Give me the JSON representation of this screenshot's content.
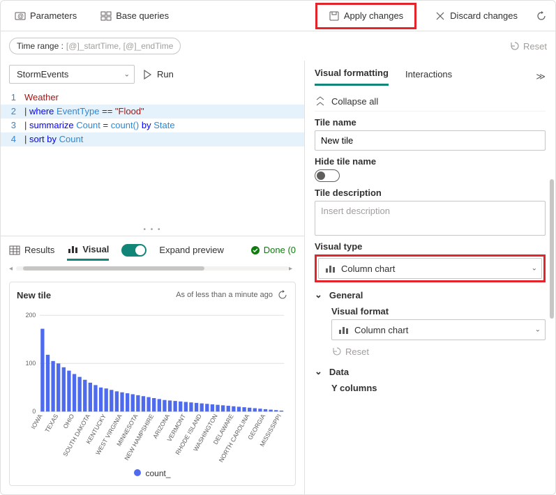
{
  "topbar": {
    "parameters": "Parameters",
    "base_queries": "Base queries",
    "apply": "Apply changes",
    "discard": "Discard changes"
  },
  "time_range": {
    "label": "Time range :",
    "value": "[@]_startTime, [@]_endTime"
  },
  "reset": "Reset",
  "datasource": "StormEvents",
  "run": "Run",
  "editor": {
    "l1": "Weather",
    "l2_kw": "where",
    "l2_col": "EventType",
    "l2_op": "==",
    "l2_str": "\"Flood\"",
    "l3_kw": "summarize",
    "l3_col": "Count",
    "l3_eq": "=",
    "l3_fn": "count()",
    "l3_by": "by",
    "l3_col2": "State",
    "l4_kw": "sort by",
    "l4_col": "Count",
    "ln1": "1",
    "ln2": "2",
    "ln3": "3",
    "ln4": "4"
  },
  "result_tabs": {
    "results": "Results",
    "visual": "Visual",
    "expand": "Expand preview",
    "done": "Done (0"
  },
  "tile": {
    "title": "New tile",
    "meta": "As of less than a minute ago"
  },
  "legend": "count_",
  "right": {
    "tab1": "Visual formatting",
    "tab2": "Interactions",
    "collapse": "Collapse all",
    "tile_name_label": "Tile name",
    "tile_name_value": "New tile",
    "hide_label": "Hide tile name",
    "desc_label": "Tile description",
    "desc_placeholder": "Insert description",
    "vtype_label": "Visual type",
    "vtype_value": "Column chart",
    "general": "General",
    "vformat_label": "Visual format",
    "vformat_value": "Column chart",
    "reset": "Reset",
    "data": "Data",
    "ycols": "Y columns"
  },
  "chart_data": {
    "type": "bar",
    "title": "New tile",
    "xlabel": "",
    "ylabel": "",
    "ylim": [
      0,
      200
    ],
    "yticks": [
      0,
      100,
      200
    ],
    "legend": [
      "count_"
    ],
    "categories": [
      "IOWA",
      "TEXAS",
      "OHIO",
      "SOUTH DAKOTA",
      "KENTUCKY",
      "WEST VIRGINIA",
      "MINNESOTA",
      "NEW HAMPSHIRE",
      "ARIZONA",
      "VERMONT",
      "RHODE ISLAND",
      "WASHINGTON",
      "DELAWARE",
      "NORTH CAROLINA",
      "GEORGIA",
      "MISSISSIPPI"
    ],
    "series": [
      {
        "name": "count_",
        "values": [
          172,
          118,
          105,
          100,
          92,
          85,
          78,
          72,
          66,
          60,
          55,
          50,
          48,
          45,
          42,
          40,
          38,
          36,
          34,
          32,
          30,
          28,
          26,
          24,
          23,
          22,
          21,
          20,
          19,
          18,
          17,
          16,
          15,
          14,
          13,
          12,
          11,
          10,
          9,
          8,
          7,
          6,
          5,
          4,
          3,
          2
        ]
      }
    ]
  }
}
